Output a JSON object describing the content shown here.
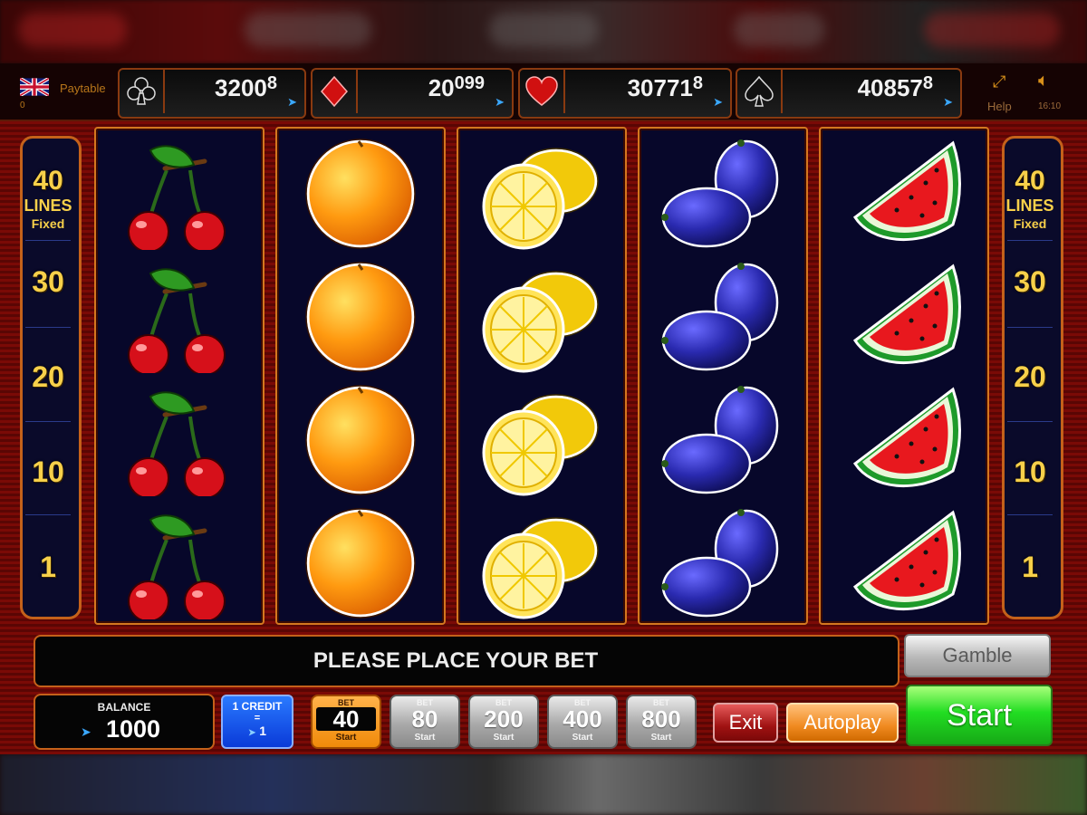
{
  "header": {
    "paytable_label": "Paytable",
    "counter": "0",
    "help_label": "Help",
    "time": "16:10"
  },
  "jackpots": [
    {
      "suit": "club-icon",
      "main": "3200",
      "cents": "8"
    },
    {
      "suit": "diamond-icon",
      "main": "20",
      "cents": "099"
    },
    {
      "suit": "heart-icon",
      "main": "30771",
      "cents": "8"
    },
    {
      "suit": "spade-icon",
      "main": "40857",
      "cents": "8"
    }
  ],
  "lines": {
    "count": "40",
    "lines_label": "LINES",
    "fixed_label": "Fixed",
    "markers": [
      "30",
      "20",
      "10",
      "1"
    ]
  },
  "reels": [
    {
      "symbol": "cherry-icon"
    },
    {
      "symbol": "orange-icon"
    },
    {
      "symbol": "lemon-icon"
    },
    {
      "symbol": "plum-icon"
    },
    {
      "symbol": "watermelon-icon"
    }
  ],
  "message": "PLEASE PLACE YOUR BET",
  "balance": {
    "label": "BALANCE",
    "value": "1000"
  },
  "credit": {
    "label": "1 CREDIT",
    "eq": "=",
    "value": "1"
  },
  "bets": [
    {
      "label": "BET",
      "value": "40",
      "start": "Start",
      "active": true
    },
    {
      "label": "BET",
      "value": "80",
      "start": "Start",
      "active": false
    },
    {
      "label": "BET",
      "value": "200",
      "start": "Start",
      "active": false
    },
    {
      "label": "BET",
      "value": "400",
      "start": "Start",
      "active": false
    },
    {
      "label": "BET",
      "value": "800",
      "start": "Start",
      "active": false
    }
  ],
  "buttons": {
    "gamble": "Gamble",
    "start": "Start",
    "exit": "Exit",
    "autoplay": "Autoplay"
  },
  "colors": {
    "frame_orange": "#d4771f",
    "reel_bg": "#07072a",
    "line_digits": "#f7d04a",
    "start_green": "#22dd22"
  }
}
